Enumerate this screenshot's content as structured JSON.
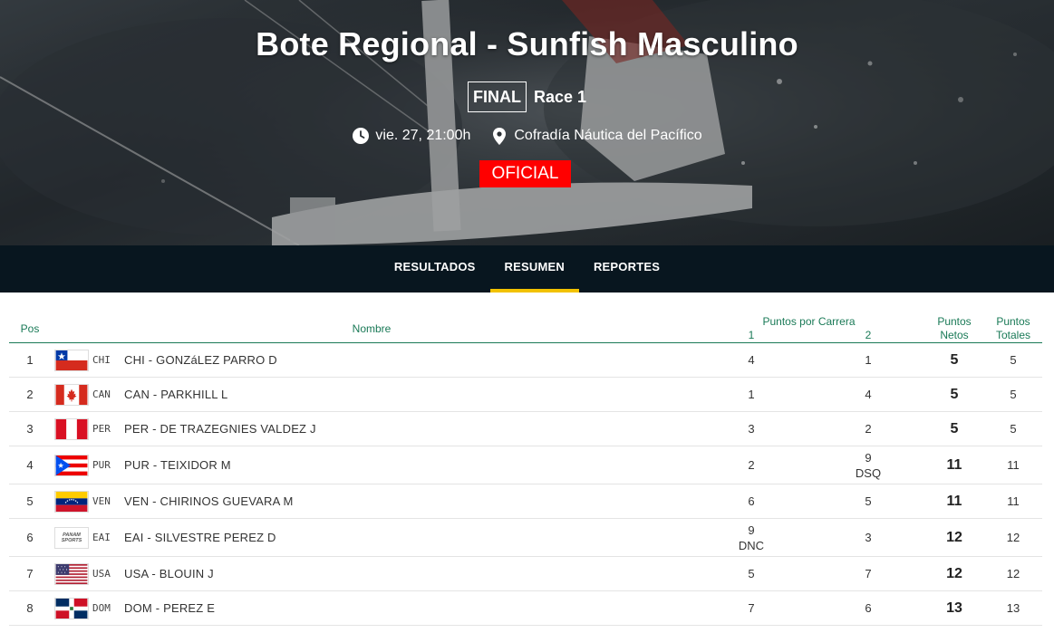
{
  "event": {
    "title": "Bote Regional - Sunfish Masculino",
    "phase": "FINAL",
    "race": "Race 1",
    "datetime": "vie. 27, 21:00h",
    "venue": "Cofradía Náutica del Pacífico",
    "status": "OFICIAL"
  },
  "nav": {
    "tabs": [
      {
        "label": "RESULTADOS",
        "active": false
      },
      {
        "label": "RESUMEN",
        "active": true
      },
      {
        "label": "REPORTES",
        "active": false
      }
    ],
    "accent": "#f2c200"
  },
  "table": {
    "headers": {
      "pos": "Pos",
      "name": "Nombre",
      "race_points": "Puntos por Carrera",
      "race1": "1",
      "race2": "2",
      "net_line1": "Puntos",
      "net_line2": "Netos",
      "total_line1": "Puntos",
      "total_line2": "Totales"
    },
    "header_color": "#1a7a57",
    "rows": [
      {
        "pos": "1",
        "code": "CHI",
        "flag": "chile-flag",
        "name": "CHI - GONZáLEZ PARRO D",
        "r1": "4",
        "r1_note": "",
        "r2": "1",
        "r2_note": "",
        "net": "5",
        "total": "5"
      },
      {
        "pos": "2",
        "code": "CAN",
        "flag": "canada-flag",
        "name": "CAN - PARKHILL L",
        "r1": "1",
        "r1_note": "",
        "r2": "4",
        "r2_note": "",
        "net": "5",
        "total": "5"
      },
      {
        "pos": "3",
        "code": "PER",
        "flag": "peru-flag",
        "name": "PER - DE TRAZEGNIES VALDEZ J",
        "r1": "3",
        "r1_note": "",
        "r2": "2",
        "r2_note": "",
        "net": "5",
        "total": "5"
      },
      {
        "pos": "4",
        "code": "PUR",
        "flag": "puerto-rico-flag",
        "name": "PUR - TEIXIDOR M",
        "r1": "2",
        "r1_note": "",
        "r2": "9",
        "r2_note": "DSQ",
        "net": "11",
        "total": "11"
      },
      {
        "pos": "5",
        "code": "VEN",
        "flag": "venezuela-flag",
        "name": "VEN - CHIRINOS GUEVARA M",
        "r1": "6",
        "r1_note": "",
        "r2": "5",
        "r2_note": "",
        "net": "11",
        "total": "11"
      },
      {
        "pos": "6",
        "code": "EAI",
        "flag": "panam-sports-logo",
        "name": "EAI - SILVESTRE PEREZ D",
        "r1": "9",
        "r1_note": "DNC",
        "r2": "3",
        "r2_note": "",
        "net": "12",
        "total": "12",
        "logo_line1": "PANAM",
        "logo_line2": "SPORTS"
      },
      {
        "pos": "7",
        "code": "USA",
        "flag": "usa-flag",
        "name": "USA - BLOUIN J",
        "r1": "5",
        "r1_note": "",
        "r2": "7",
        "r2_note": "",
        "net": "12",
        "total": "12"
      },
      {
        "pos": "8",
        "code": "DOM",
        "flag": "dominican-republic-flag",
        "name": "DOM - PEREZ E",
        "r1": "7",
        "r1_note": "",
        "r2": "6",
        "r2_note": "",
        "net": "13",
        "total": "13"
      }
    ]
  },
  "colors": {
    "status_red": "#ff0000",
    "nav_bg": "#08161f"
  }
}
